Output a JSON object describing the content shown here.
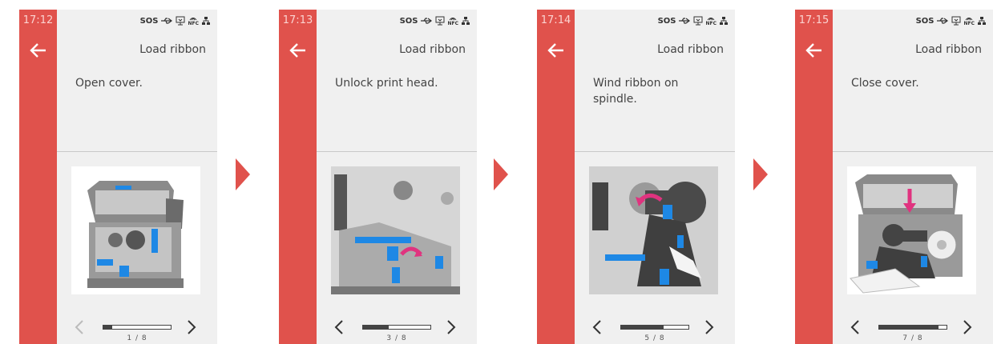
{
  "screens": [
    {
      "time": "17:12",
      "title": "Load ribbon",
      "instruction": "Open cover.",
      "illustration": "printer-cover-open-illustration",
      "progress": 0.125,
      "page": "1 / 8",
      "prev_disabled": true
    },
    {
      "time": "17:13",
      "title": "Load ribbon",
      "instruction": "Unlock print head.",
      "illustration": "printhead-unlock-illustration",
      "progress": 0.375,
      "page": "3 / 8",
      "prev_disabled": false
    },
    {
      "time": "17:14",
      "title": "Load ribbon",
      "instruction": "Wind ribbon on spindle.",
      "illustration": "ribbon-spindle-illustration",
      "progress": 0.625,
      "page": "5 / 8",
      "prev_disabled": false
    },
    {
      "time": "17:15",
      "title": "Load ribbon",
      "instruction": "Close cover.",
      "illustration": "printer-cover-close-illustration",
      "progress": 0.875,
      "page": "7 / 8",
      "prev_disabled": false
    }
  ],
  "status_icons": [
    "sos-icon",
    "usb-icon",
    "monitor-icon",
    "nfc-icon",
    "network-icon"
  ],
  "status_text": {
    "sos": "SOS",
    "nfc": "NFC"
  },
  "colors": {
    "accent": "#e0524c",
    "highlight_blue": "#1e88e5",
    "highlight_magenta": "#e0337f"
  }
}
